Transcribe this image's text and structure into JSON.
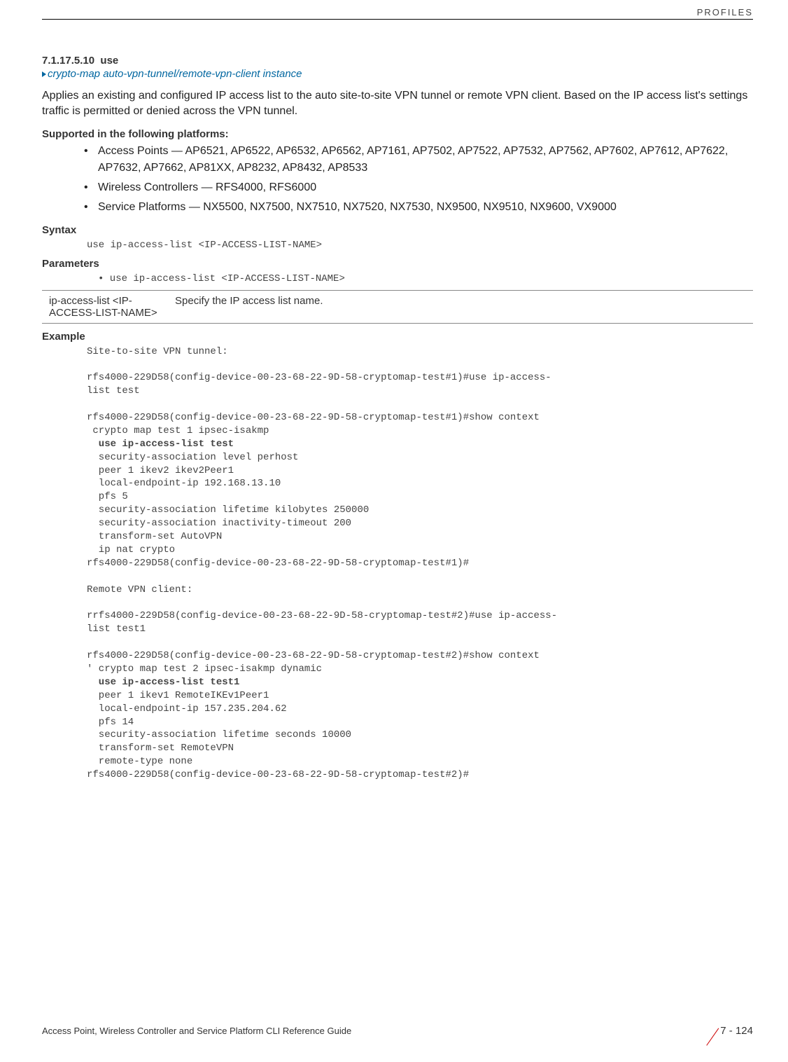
{
  "header": {
    "category": "PROFILES"
  },
  "section": {
    "number": "7.1.17.5.10",
    "title": "use",
    "breadcrumb": "crypto-map auto-vpn-tunnel/remote-vpn-client instance"
  },
  "description": "Applies an existing and configured IP access list to the auto site-to-site VPN tunnel or remote VPN client. Based on the IP access list's settings traffic is permitted or denied across the VPN tunnel.",
  "supported_heading": "Supported in the following platforms:",
  "supported": [
    "Access Points — AP6521, AP6522, AP6532, AP6562, AP7161, AP7502, AP7522, AP7532, AP7562, AP7602, AP7612, AP7622, AP7632, AP7662, AP81XX, AP8232, AP8432, AP8533",
    "Wireless Controllers — RFS4000, RFS6000",
    "Service Platforms — NX5500, NX7500, NX7510, NX7520, NX7530, NX9500, NX9510, NX9600, VX9000"
  ],
  "syntax_heading": "Syntax",
  "syntax": "use ip-access-list <IP-ACCESS-LIST-NAME>",
  "parameters_heading": "Parameters",
  "parameters_line": "• use ip-access-list <IP-ACCESS-LIST-NAME>",
  "param_table": {
    "left": "ip-access-list <IP-ACCESS-LIST-NAME>",
    "right": "Specify the IP access list name."
  },
  "example_heading": "Example",
  "example": {
    "l1": "Site-to-site VPN tunnel:",
    "l2": "rfs4000-229D58(config-device-00-23-68-22-9D-58-cryptomap-test#1)#use ip-access-\nlist test",
    "l3": "rfs4000-229D58(config-device-00-23-68-22-9D-58-cryptomap-test#1)#show context\n crypto map test 1 ipsec-isakmp",
    "l4": "  use ip-access-list test",
    "l5": "  security-association level perhost\n  peer 1 ikev2 ikev2Peer1\n  local-endpoint-ip 192.168.13.10\n  pfs 5\n  security-association lifetime kilobytes 250000\n  security-association inactivity-timeout 200\n  transform-set AutoVPN\n  ip nat crypto\nrfs4000-229D58(config-device-00-23-68-22-9D-58-cryptomap-test#1)#",
    "l6": "Remote VPN client:",
    "l7": "rrfs4000-229D58(config-device-00-23-68-22-9D-58-cryptomap-test#2)#use ip-access-\nlist test1",
    "l8": "rfs4000-229D58(config-device-00-23-68-22-9D-58-cryptomap-test#2)#show context\n' crypto map test 2 ipsec-isakmp dynamic",
    "l9": "  use ip-access-list test1",
    "l10": "  peer 1 ikev1 RemoteIKEv1Peer1\n  local-endpoint-ip 157.235.204.62\n  pfs 14\n  security-association lifetime seconds 10000\n  transform-set RemoteVPN\n  remote-type none\nrfs4000-229D58(config-device-00-23-68-22-9D-58-cryptomap-test#2)#"
  },
  "footer": {
    "left": "Access Point, Wireless Controller and Service Platform CLI Reference Guide",
    "page": "7 - 124"
  }
}
